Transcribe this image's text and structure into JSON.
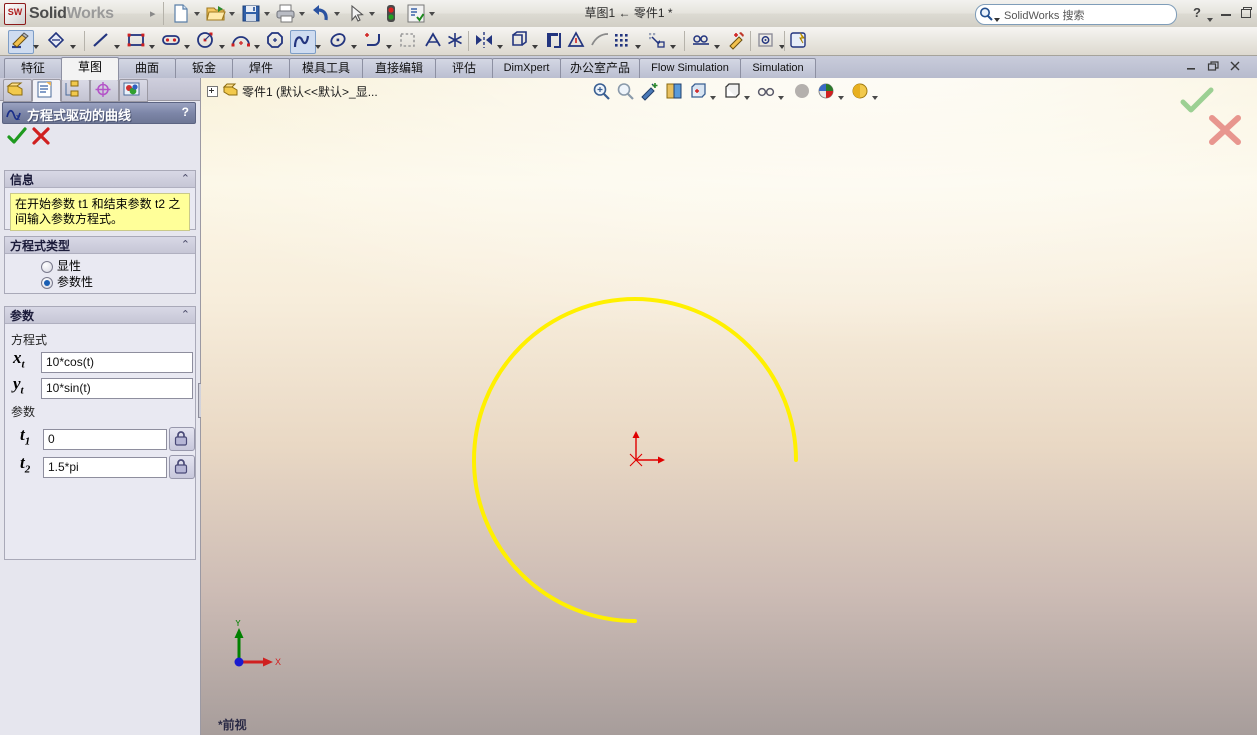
{
  "app": {
    "brand_solid": "Solid",
    "brand_works": "Works",
    "brand_arrow": "▸",
    "document_title": "草图1 ← 零件1 *"
  },
  "titlebar": {
    "buttons": [
      {
        "name": "new-document",
        "label": "新建",
        "icon": "new-file-icon",
        "dropdown": true
      },
      {
        "name": "open-document",
        "label": "打开",
        "icon": "open-folder-icon",
        "dropdown": true
      },
      {
        "name": "save-document",
        "label": "保存",
        "icon": "floppy-save-icon",
        "dropdown": true
      },
      {
        "name": "print-document",
        "label": "打印",
        "icon": "printer-icon",
        "dropdown": true
      },
      {
        "name": "undo",
        "label": "撤消",
        "icon": "undo-arrow-icon",
        "dropdown": true
      },
      {
        "name": "select",
        "label": "选择",
        "icon": "cursor-arrow-icon",
        "dropdown": true
      },
      {
        "name": "rebuild",
        "label": "重建模型",
        "icon": "traffic-light-icon",
        "dropdown": false
      },
      {
        "name": "options",
        "label": "选项",
        "icon": "options-list-icon",
        "dropdown": true
      }
    ],
    "search": {
      "placeholder": "SolidWorks 搜索",
      "icon": "magnifier-icon"
    },
    "help_label": "?",
    "window_minimize": "minimize-icon",
    "window_restore": "restore-icon"
  },
  "sketch_toolbar": {
    "items": [
      {
        "name": "sketch-button",
        "icon": "pencil-sketch-icon",
        "dropdown": true,
        "selected": true
      },
      {
        "name": "smart-dimension",
        "icon": "smart-dimension-icon",
        "dropdown": true,
        "selected": false
      },
      {
        "name": "line-tool",
        "icon": "line-icon",
        "dropdown": true,
        "selected": false
      },
      {
        "name": "rectangle-tool",
        "icon": "rectangle-icon",
        "dropdown": true,
        "selected": false
      },
      {
        "name": "slot-tool",
        "icon": "slot-icon",
        "dropdown": true,
        "selected": false
      },
      {
        "name": "circle-tool",
        "icon": "circle-icon",
        "dropdown": true,
        "selected": false
      },
      {
        "name": "arc-tool",
        "icon": "arc-icon",
        "dropdown": true,
        "selected": false
      },
      {
        "name": "polygon-tool",
        "icon": "polygon-icon",
        "dropdown": false,
        "selected": false
      },
      {
        "name": "spline-tool",
        "icon": "spline-icon",
        "dropdown": true,
        "selected": true
      },
      {
        "name": "ellipse-tool",
        "icon": "ellipse-icon",
        "dropdown": true,
        "selected": false
      },
      {
        "name": "fillet-tool",
        "icon": "sketch-fillet-icon",
        "dropdown": true,
        "selected": false
      },
      {
        "name": "trim-entities",
        "icon": "trim-icon",
        "dropdown": false,
        "selected": false
      },
      {
        "name": "text-tool",
        "icon": "text-a-icon",
        "dropdown": false,
        "selected": false
      },
      {
        "name": "point-tool",
        "icon": "point-star-icon",
        "dropdown": false,
        "selected": false
      },
      {
        "name": "mirror-entities",
        "icon": "mirror-icon",
        "dropdown": true,
        "selected": false
      },
      {
        "name": "convert-entities",
        "icon": "convert-entities-icon",
        "dropdown": true,
        "selected": false
      },
      {
        "name": "offset-entities",
        "icon": "offset-icon",
        "dropdown": false,
        "selected": false
      },
      {
        "name": "add-relation",
        "icon": "relation-icon",
        "dropdown": false,
        "selected": false
      },
      {
        "name": "construction-geometry",
        "icon": "construction-line-icon",
        "dropdown": false,
        "selected": false
      },
      {
        "name": "linear-pattern",
        "icon": "linear-pattern-icon",
        "dropdown": true,
        "selected": false
      },
      {
        "name": "move-entities",
        "icon": "move-entities-icon",
        "dropdown": true,
        "selected": false
      },
      {
        "name": "repair-sketch",
        "icon": "repair-sketch-icon",
        "dropdown": true,
        "selected": false
      },
      {
        "name": "quick-snaps",
        "icon": "quick-snap-icon",
        "dropdown": false,
        "selected": false
      },
      {
        "name": "display-delete-relations",
        "icon": "display-relations-icon",
        "dropdown": true,
        "selected": false
      },
      {
        "name": "rapid-sketch",
        "icon": "rapid-sketch-icon",
        "dropdown": false,
        "selected": false
      }
    ]
  },
  "tabs": {
    "items": [
      {
        "label": "特征",
        "latin": false,
        "active": false
      },
      {
        "label": "草图",
        "latin": false,
        "active": true
      },
      {
        "label": "曲面",
        "latin": false,
        "active": false
      },
      {
        "label": "钣金",
        "latin": false,
        "active": false
      },
      {
        "label": "焊件",
        "latin": false,
        "active": false
      },
      {
        "label": "模具工具",
        "latin": false,
        "active": false
      },
      {
        "label": "直接编辑",
        "latin": false,
        "active": false
      },
      {
        "label": "评估",
        "latin": false,
        "active": false
      },
      {
        "label": "DimXpert",
        "latin": true,
        "active": false
      },
      {
        "label": "办公室产品",
        "latin": false,
        "active": false
      },
      {
        "label": "Flow Simulation",
        "latin": true,
        "active": false
      },
      {
        "label": "Simulation",
        "latin": true,
        "active": false
      }
    ]
  },
  "panel": {
    "tabs": [
      {
        "name": "feature-manager-tab",
        "icon": "feature-tree-icon",
        "active": false
      },
      {
        "name": "property-manager-tab",
        "icon": "property-manager-icon",
        "active": true
      },
      {
        "name": "configuration-manager-tab",
        "icon": "configuration-icon",
        "active": false
      },
      {
        "name": "dimxpert-manager-tab",
        "icon": "dimxpert-target-icon",
        "active": false
      },
      {
        "name": "display-manager-tab",
        "icon": "display-manager-icon",
        "active": false
      }
    ],
    "title": "方程式驱动的曲线",
    "title_icon": "equation-curve-icon",
    "help_label": "?",
    "ok_icon": "green-check-icon",
    "cancel_icon": "red-x-icon",
    "info": {
      "header": "信息",
      "collapse_icon": "chevron-up-icon",
      "text": "在开始参数 t1 和结束参数 t2 之间输入参数方程式。"
    },
    "equation_type": {
      "header": "方程式类型",
      "collapse_icon": "chevron-up-icon",
      "options": [
        {
          "label": "显性",
          "selected": false
        },
        {
          "label": "参数性",
          "selected": true
        }
      ]
    },
    "parameters": {
      "header": "参数",
      "collapse_icon": "chevron-up-icon",
      "equation_label": "方程式",
      "equations": [
        {
          "var": "x",
          "sub": "t",
          "value": "10*cos(t)"
        },
        {
          "var": "y",
          "sub": "t",
          "value": "10*sin(t)"
        }
      ],
      "parameter_label": "参数",
      "params": [
        {
          "var": "t",
          "sub": "1",
          "value": "0",
          "lock_icon": "lock-icon"
        },
        {
          "var": "t",
          "sub": "2",
          "value": "1.5*pi",
          "lock_icon": "lock-icon"
        }
      ]
    },
    "splitter_icon": "collapse-left-arrows"
  },
  "graphics": {
    "breadcrumb": "零件1  (默认<<默认>_显...",
    "breadcrumb_icon": "part-icon",
    "expand_icon": "plus-box-icon",
    "view_toolbar": [
      {
        "name": "zoom-to-fit",
        "icon": "zoom-fit-icon",
        "dropdown": false
      },
      {
        "name": "zoom-to-area",
        "icon": "zoom-area-icon",
        "dropdown": false
      },
      {
        "name": "previous-view",
        "icon": "previous-view-icon",
        "dropdown": false
      },
      {
        "name": "section-view",
        "icon": "section-view-icon",
        "dropdown": false
      },
      {
        "name": "view-orientation",
        "icon": "view-orientation-icon",
        "dropdown": true
      },
      {
        "name": "display-style",
        "icon": "display-style-icon",
        "dropdown": true
      },
      {
        "name": "hide-show-items",
        "icon": "glasses-icon",
        "dropdown": true
      },
      {
        "name": "edit-appearance",
        "icon": "sphere-appearance-icon",
        "dropdown": false
      },
      {
        "name": "apply-scene",
        "icon": "scene-ball-icon",
        "dropdown": true
      },
      {
        "name": "view-settings",
        "icon": "shadow-ball-icon",
        "dropdown": true
      }
    ],
    "confirm_ok_icon": "green-check-icon",
    "confirm_cancel_icon": "red-x-icon",
    "triad": {
      "x_label": "X",
      "y_label": "Y"
    },
    "status_view": "*前视",
    "curve": {
      "color": "#FFF000",
      "equation_x": "10*cos(t)",
      "equation_y": "10*sin(t)",
      "t_start": "0",
      "t_end": "1.5*pi",
      "origin_color": "#E00000"
    }
  },
  "colors": {
    "accent_blue": "#7d86a8",
    "info_yellow": "#ffff99",
    "curve_yellow": "#fff000",
    "origin_red": "#e00000",
    "axis_green": "#008000"
  }
}
